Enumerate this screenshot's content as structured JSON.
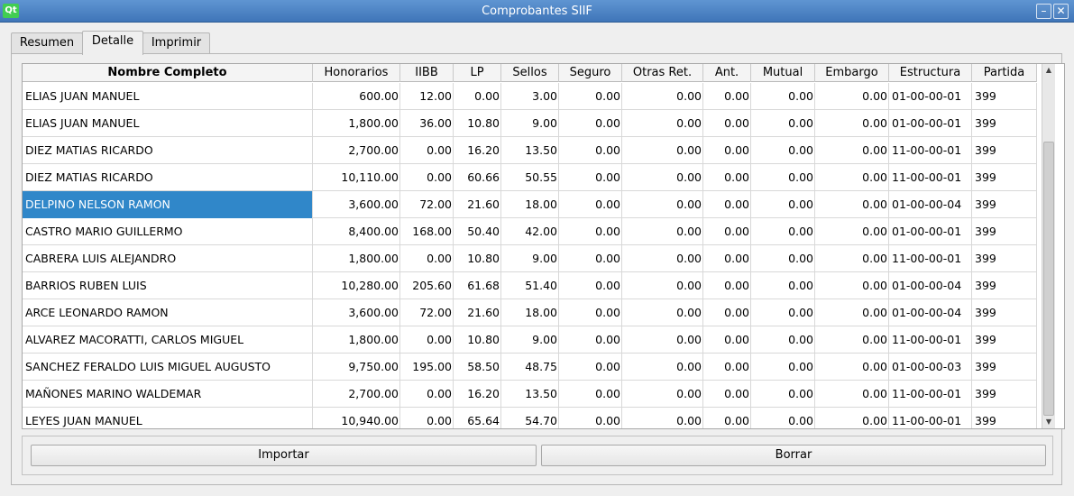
{
  "window": {
    "title": "Comprobantes SIIF",
    "logo_text": "Qt",
    "minimize_glyph": "–",
    "close_glyph": "✕"
  },
  "tabs": [
    {
      "label": "Resumen",
      "active": false
    },
    {
      "label": "Detalle",
      "active": true
    },
    {
      "label": "Imprimir",
      "active": false
    }
  ],
  "table": {
    "columns": [
      "Nombre Completo",
      "Honorarios",
      "IIBB",
      "LP",
      "Sellos",
      "Seguro",
      "Otras Ret.",
      "Ant.",
      "Mutual",
      "Embargo",
      "Estructura",
      "Partida"
    ],
    "rows": [
      [
        "ELIAS JUAN MANUEL",
        "600.00",
        "12.00",
        "0.00",
        "3.00",
        "0.00",
        "0.00",
        "0.00",
        "0.00",
        "0.00",
        "01-00-00-01",
        "399"
      ],
      [
        "ELIAS JUAN MANUEL",
        "1,800.00",
        "36.00",
        "10.80",
        "9.00",
        "0.00",
        "0.00",
        "0.00",
        "0.00",
        "0.00",
        "01-00-00-01",
        "399"
      ],
      [
        "DIEZ MATIAS RICARDO",
        "2,700.00",
        "0.00",
        "16.20",
        "13.50",
        "0.00",
        "0.00",
        "0.00",
        "0.00",
        "0.00",
        "11-00-00-01",
        "399"
      ],
      [
        "DIEZ MATIAS RICARDO",
        "10,110.00",
        "0.00",
        "60.66",
        "50.55",
        "0.00",
        "0.00",
        "0.00",
        "0.00",
        "0.00",
        "11-00-00-01",
        "399"
      ],
      [
        "DELPINO NELSON RAMON",
        "3,600.00",
        "72.00",
        "21.60",
        "18.00",
        "0.00",
        "0.00",
        "0.00",
        "0.00",
        "0.00",
        "01-00-00-04",
        "399"
      ],
      [
        "CASTRO MARIO GUILLERMO",
        "8,400.00",
        "168.00",
        "50.40",
        "42.00",
        "0.00",
        "0.00",
        "0.00",
        "0.00",
        "0.00",
        "01-00-00-01",
        "399"
      ],
      [
        "CABRERA LUIS ALEJANDRO",
        "1,800.00",
        "0.00",
        "10.80",
        "9.00",
        "0.00",
        "0.00",
        "0.00",
        "0.00",
        "0.00",
        "11-00-00-01",
        "399"
      ],
      [
        "BARRIOS RUBEN LUIS",
        "10,280.00",
        "205.60",
        "61.68",
        "51.40",
        "0.00",
        "0.00",
        "0.00",
        "0.00",
        "0.00",
        "01-00-00-04",
        "399"
      ],
      [
        "ARCE LEONARDO RAMON",
        "3,600.00",
        "72.00",
        "21.60",
        "18.00",
        "0.00",
        "0.00",
        "0.00",
        "0.00",
        "0.00",
        "01-00-00-04",
        "399"
      ],
      [
        "ALVAREZ MACORATTI, CARLOS MIGUEL",
        "1,800.00",
        "0.00",
        "10.80",
        "9.00",
        "0.00",
        "0.00",
        "0.00",
        "0.00",
        "0.00",
        "11-00-00-01",
        "399"
      ],
      [
        "SANCHEZ FERALDO LUIS MIGUEL AUGUSTO",
        "9,750.00",
        "195.00",
        "58.50",
        "48.75",
        "0.00",
        "0.00",
        "0.00",
        "0.00",
        "0.00",
        "01-00-00-03",
        "399"
      ],
      [
        "MAÑONES MARINO WALDEMAR",
        "2,700.00",
        "0.00",
        "16.20",
        "13.50",
        "0.00",
        "0.00",
        "0.00",
        "0.00",
        "0.00",
        "11-00-00-01",
        "399"
      ],
      [
        "LEYES JUAN MANUEL",
        "10,940.00",
        "0.00",
        "65.64",
        "54.70",
        "0.00",
        "0.00",
        "0.00",
        "0.00",
        "0.00",
        "11-00-00-01",
        "399"
      ]
    ],
    "selected_row": 4,
    "selected_col": 0,
    "selection_color": "#3087c9"
  },
  "scrollbar": {
    "up_glyph": "▲",
    "down_glyph": "▼"
  },
  "buttons": {
    "import_label": "Importar",
    "delete_label": "Borrar"
  }
}
